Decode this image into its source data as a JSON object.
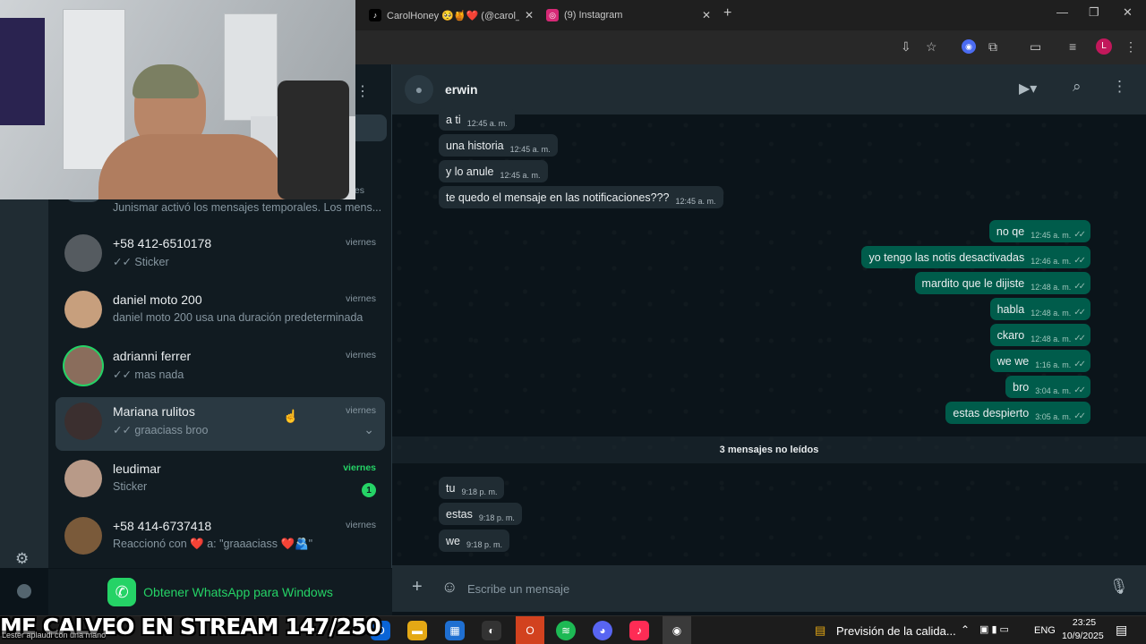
{
  "browser": {
    "tabs": [
      {
        "title": "CarolHoney 🥺🍯❤️ (@carol_h",
        "favicon": "tiktok-icon",
        "color": "#000000"
      },
      {
        "title": "(9) Instagram",
        "favicon": "instagram-icon",
        "color": "#d62976"
      }
    ],
    "new_tab": "+",
    "profile_initial": "L"
  },
  "chat_list": {
    "partial_date": "es",
    "partial_preview": "Junismar activó los mensajes temporales. Los mens...",
    "items": [
      {
        "name": "+58 412-6510178",
        "preview": "✓✓ Sticker",
        "date": "viernes",
        "avatar_color": "#555b60"
      },
      {
        "name": "daniel moto 200",
        "preview": "daniel moto 200 usa una duración predeterminada ...",
        "date": "viernes",
        "avatar_color": "#c79f7d"
      },
      {
        "name": "adrianni ferrer",
        "preview": "✓✓ mas nada",
        "date": "viernes",
        "avatar_color": "#8a6d5c"
      },
      {
        "name": "Mariana rulitos",
        "preview": "✓✓ graaciass broo",
        "date": "viernes",
        "avatar_color": "#3b2f2f"
      },
      {
        "name": "leudimar",
        "preview": "Sticker",
        "date": "viernes",
        "unread": "1",
        "avatar_color": "#b89a88"
      },
      {
        "name": "+58 414-6737418",
        "preview": "Reaccionó con ❤️ a: \"graaaciass ❤️🫂\"",
        "date": "viernes",
        "avatar_color": "#7a5a3a"
      }
    ],
    "get_app": "Obtener WhatsApp para Windows"
  },
  "chat": {
    "contact": "erwin",
    "incoming_top": [
      {
        "text": "a ti",
        "time": "12:45 a. m."
      },
      {
        "text": "una historia",
        "time": "12:45 a. m."
      },
      {
        "text": "y lo anule",
        "time": "12:45 a. m."
      },
      {
        "text": "te quedo el mensaje en las notificaciones???",
        "time": "12:45 a. m."
      }
    ],
    "outgoing": [
      {
        "text": "no qe",
        "time": "12:45 a. m."
      },
      {
        "text": "yo tengo las notis desactivadas",
        "time": "12:46 a. m."
      },
      {
        "text": "mardito que le dijiste",
        "time": "12:48 a. m."
      },
      {
        "text": "habla",
        "time": "12:48 a. m."
      },
      {
        "text": "ckaro",
        "time": "12:48 a. m."
      },
      {
        "text": "we we",
        "time": "1:16 a. m."
      },
      {
        "text": "bro",
        "time": "3:04 a. m."
      },
      {
        "text": "estas despierto",
        "time": "3:05 a. m."
      }
    ],
    "unread_label": "3 mensajes no leídos",
    "incoming_bottom": [
      {
        "text": "tu",
        "time": "9:18 p. m."
      },
      {
        "text": "estas",
        "time": "9:18 p. m."
      },
      {
        "text": "we",
        "time": "9:18 p. m."
      }
    ],
    "composer_placeholder": "Escribe un mensaje"
  },
  "stream_overlay": {
    "title": "ME CALVEO EN STREAM 147/250",
    "ticker": "Lester aplaudi con una mano"
  },
  "taskbar": {
    "weather": "Previsión de la calida...",
    "lang": "ENG",
    "time": "23:25",
    "date": "10/9/2025",
    "notif_count": "3"
  }
}
